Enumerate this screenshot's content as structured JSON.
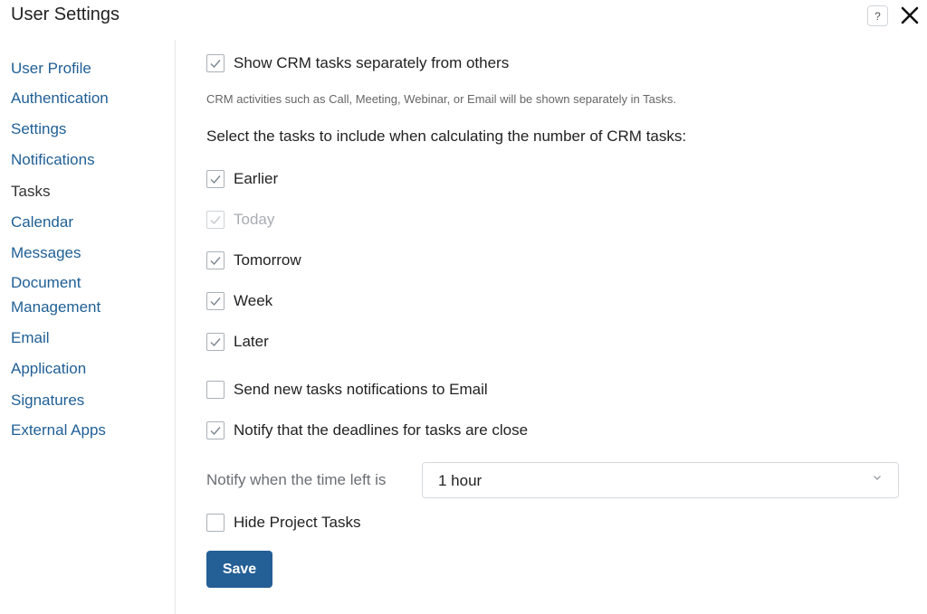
{
  "header": {
    "title": "User Settings",
    "help_label": "?",
    "help_icon": "help-icon",
    "close_icon": "close-icon"
  },
  "sidebar": {
    "items": [
      {
        "label": "User Profile",
        "active": false
      },
      {
        "label": "Authentication",
        "active": false
      },
      {
        "label": "Settings",
        "active": false
      },
      {
        "label": "Notifications",
        "active": false
      },
      {
        "label": "Tasks",
        "active": true
      },
      {
        "label": "Calendar",
        "active": false
      },
      {
        "label": "Messages",
        "active": false
      },
      {
        "label": "Document",
        "active": false
      },
      {
        "label": "Management",
        "active": false
      },
      {
        "label": "Email",
        "active": false
      },
      {
        "label": "Application",
        "active": false
      },
      {
        "label": "Signatures",
        "active": false
      },
      {
        "label": "External Apps",
        "active": false
      }
    ]
  },
  "main": {
    "show_crm_separately": {
      "label": "Show CRM tasks separately from others",
      "checked": true
    },
    "hint": "CRM activities such as Call, Meeting, Webinar, or Email will be shown separately in Tasks.",
    "select_tasks_title": "Select the tasks to include when calculating the number of CRM tasks:",
    "task_periods": [
      {
        "label": "Earlier",
        "checked": true,
        "disabled": false
      },
      {
        "label": "Today",
        "checked": true,
        "disabled": true
      },
      {
        "label": "Tomorrow",
        "checked": true,
        "disabled": false
      },
      {
        "label": "Week",
        "checked": true,
        "disabled": false
      },
      {
        "label": "Later",
        "checked": true,
        "disabled": false
      }
    ],
    "send_email": {
      "label": "Send new tasks notifications to Email",
      "checked": false
    },
    "notify_deadlines": {
      "label": "Notify that the deadlines for tasks are close",
      "checked": true
    },
    "notify_time": {
      "label": "Notify when the time left is",
      "value": "1 hour"
    },
    "hide_project_tasks": {
      "label": "Hide Project Tasks",
      "checked": false
    },
    "save_label": "Save"
  },
  "colors": {
    "link": "#1f5f96",
    "accent": "#245f96",
    "check": "#7a858f",
    "disabled": "#a8adb2"
  }
}
